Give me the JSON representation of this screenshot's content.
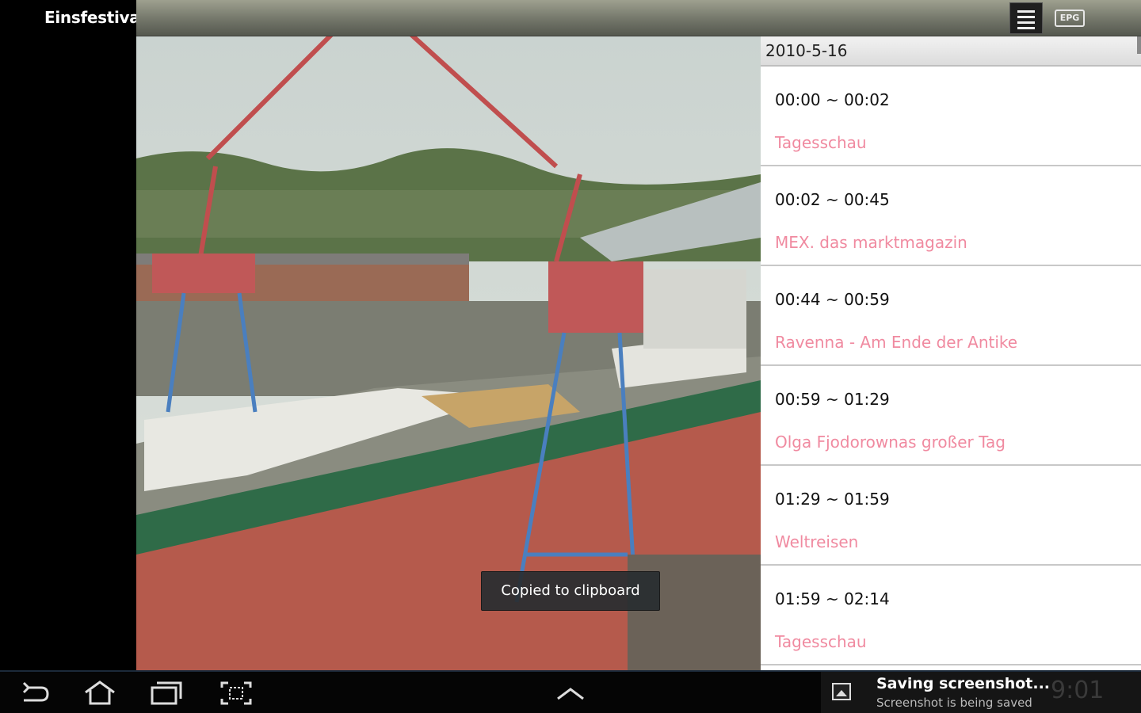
{
  "channel": {
    "name": "Einsfestival"
  },
  "toolbar": {
    "epg_label": "EPG"
  },
  "epg": {
    "date": "2010-5-16",
    "items": [
      {
        "time": "00:00 ~ 00:02",
        "title": "Tagesschau"
      },
      {
        "time": "00:02 ~ 00:45",
        "title": "MEX. das marktmagazin"
      },
      {
        "time": "00:44 ~ 00:59",
        "title": "Ravenna - Am Ende der Antike"
      },
      {
        "time": "00:59 ~ 01:29",
        "title": "Olga Fjodorownas großer Tag"
      },
      {
        "time": "01:29 ~ 01:59",
        "title": "Weltreisen"
      },
      {
        "time": "01:59 ~ 02:14",
        "title": "Tagesschau"
      }
    ]
  },
  "toast": {
    "text": "Copied to clipboard"
  },
  "notification": {
    "title": "Saving screenshot...",
    "subtitle": "Screenshot is being saved",
    "clock": "9:01"
  },
  "colors": {
    "program_title": "#f08aa0",
    "toast_bg": "#282c30"
  }
}
